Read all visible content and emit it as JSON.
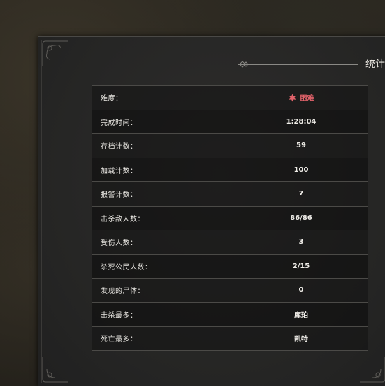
{
  "panel": {
    "title": "统计"
  },
  "colors": {
    "difficulty": "#e0626a",
    "text": "#e8e6e1",
    "panel_bg": "#262625"
  },
  "stats": [
    {
      "label": "难度：",
      "value": "困难",
      "icon": "difficulty-star-icon"
    },
    {
      "label": "完成时间：",
      "value": "1:28:04"
    },
    {
      "label": "存档计数：",
      "value": "59"
    },
    {
      "label": "加载计数：",
      "value": "100"
    },
    {
      "label": "报警计数：",
      "value": "7"
    },
    {
      "label": "击杀敌人数：",
      "value": "86/86"
    },
    {
      "label": "受伤人数：",
      "value": "3"
    },
    {
      "label": "杀死公民人数：",
      "value": "2/15"
    },
    {
      "label": "发现的尸体：",
      "value": "0"
    },
    {
      "label": "击杀最多：",
      "value": "库珀"
    },
    {
      "label": "死亡最多：",
      "value": "凯特"
    }
  ]
}
